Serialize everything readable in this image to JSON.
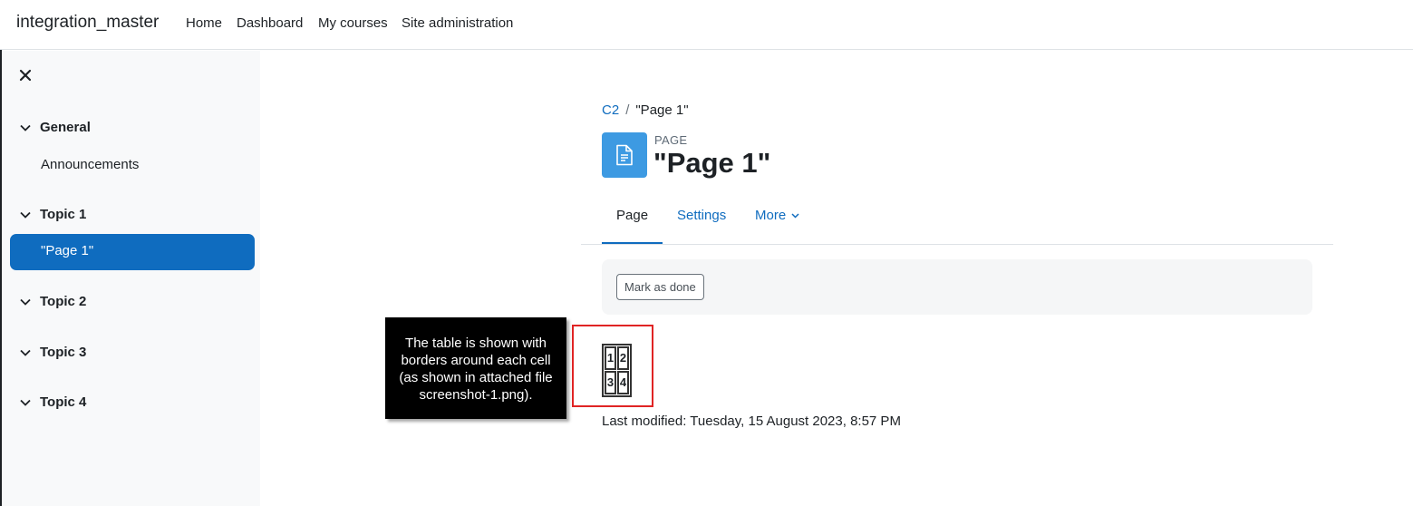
{
  "navbar": {
    "site_name": "integration_master",
    "links": [
      "Home",
      "Dashboard",
      "My courses",
      "Site administration"
    ]
  },
  "drawer": {
    "sections": [
      {
        "title": "General",
        "items": [
          "Announcements"
        ]
      },
      {
        "title": "Topic 1",
        "items": [
          "\"Page 1\""
        ],
        "active_item": "\"Page 1\""
      },
      {
        "title": "Topic 2",
        "items": []
      },
      {
        "title": "Topic 3",
        "items": []
      },
      {
        "title": "Topic 4",
        "items": []
      }
    ]
  },
  "breadcrumb": {
    "course": "C2",
    "separator": "/",
    "current": "\"Page 1\""
  },
  "header": {
    "activity_type": "PAGE",
    "title": "\"Page 1\""
  },
  "tabs": {
    "page": "Page",
    "settings": "Settings",
    "more": "More",
    "active": "Page"
  },
  "completion": {
    "mark_done_label": "Mark as done"
  },
  "content_table": {
    "rows": [
      [
        "1",
        "2"
      ],
      [
        "3",
        "4"
      ]
    ]
  },
  "callout": {
    "text": "The table is shown with borders around each cell (as shown in attached file screenshot-1.png)."
  },
  "last_modified": "Last modified: Tuesday, 15 August 2023, 8:57 PM",
  "colors": {
    "accent": "#0f6cbf",
    "page_icon": "#3d9ae2",
    "highlight": "#e02424"
  }
}
